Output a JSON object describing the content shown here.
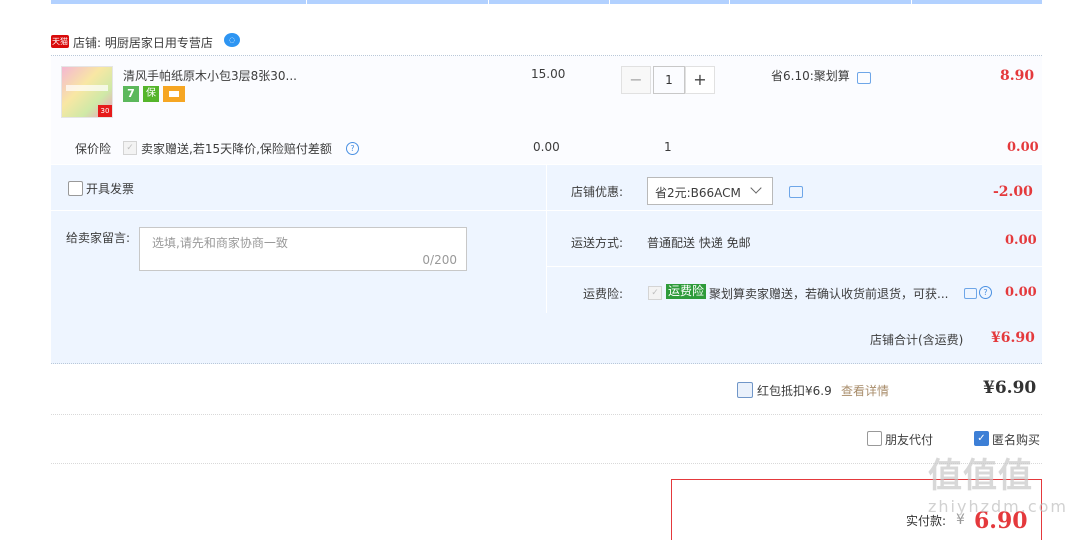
{
  "shop": {
    "badge": "天猫",
    "name": "店铺: 明厨居家日用专营店",
    "ww_icon": "chat-bubble-icon"
  },
  "item": {
    "title": "清风手帕纸原木小包3层8张30...",
    "thumb_tag": "30",
    "badge_7": "7",
    "badge_shield": "保",
    "price": "15.00",
    "quantity": "1",
    "qty_minus": "−",
    "qty_plus": "+",
    "promo": "省6.10:聚划算",
    "subtotal": "8.90"
  },
  "insurance": {
    "label": "保价险",
    "check": "✓",
    "text": "卖家赠送,若15天降价,保险赔付差额",
    "help": "?",
    "price": "0.00",
    "quantity": "1",
    "subtotal": "0.00"
  },
  "invoice": {
    "label": "开具发票"
  },
  "message": {
    "label": "给卖家留言:",
    "placeholder": "选填,请先和商家协商一致",
    "count": "0/200"
  },
  "coupon": {
    "label": "店铺优惠:",
    "value": "省2元:B66ACM",
    "amount": "-2.00"
  },
  "shipping": {
    "label": "运送方式:",
    "value": "普通配送 快递 免邮",
    "amount": "0.00"
  },
  "return_insurance": {
    "label": "运费险:",
    "check": "✓",
    "tag": "运费险",
    "text": "聚划算卖家赠送，若确认收货前退货，可获...",
    "help": "?",
    "amount": "0.00"
  },
  "shop_total": {
    "label": "店铺合计(含运费)",
    "amount": "¥6.90"
  },
  "red_packet": {
    "label": "红包抵扣¥6.9",
    "link": "查看详情",
    "amount": "¥6.90"
  },
  "options": {
    "friend_pay": "朋友代付",
    "anonymous_check": "✓",
    "anonymous": "匿名购买"
  },
  "payment": {
    "label": "实付款:",
    "currency": "¥",
    "amount": "6.90"
  },
  "watermark": {
    "text": "值值值",
    "site": "zhiyhzdm.com"
  },
  "colors": {
    "accent": "#e4393c",
    "panel": "#eef5ff",
    "link": "#a88c6a",
    "check_blue": "#3d7fd6"
  }
}
